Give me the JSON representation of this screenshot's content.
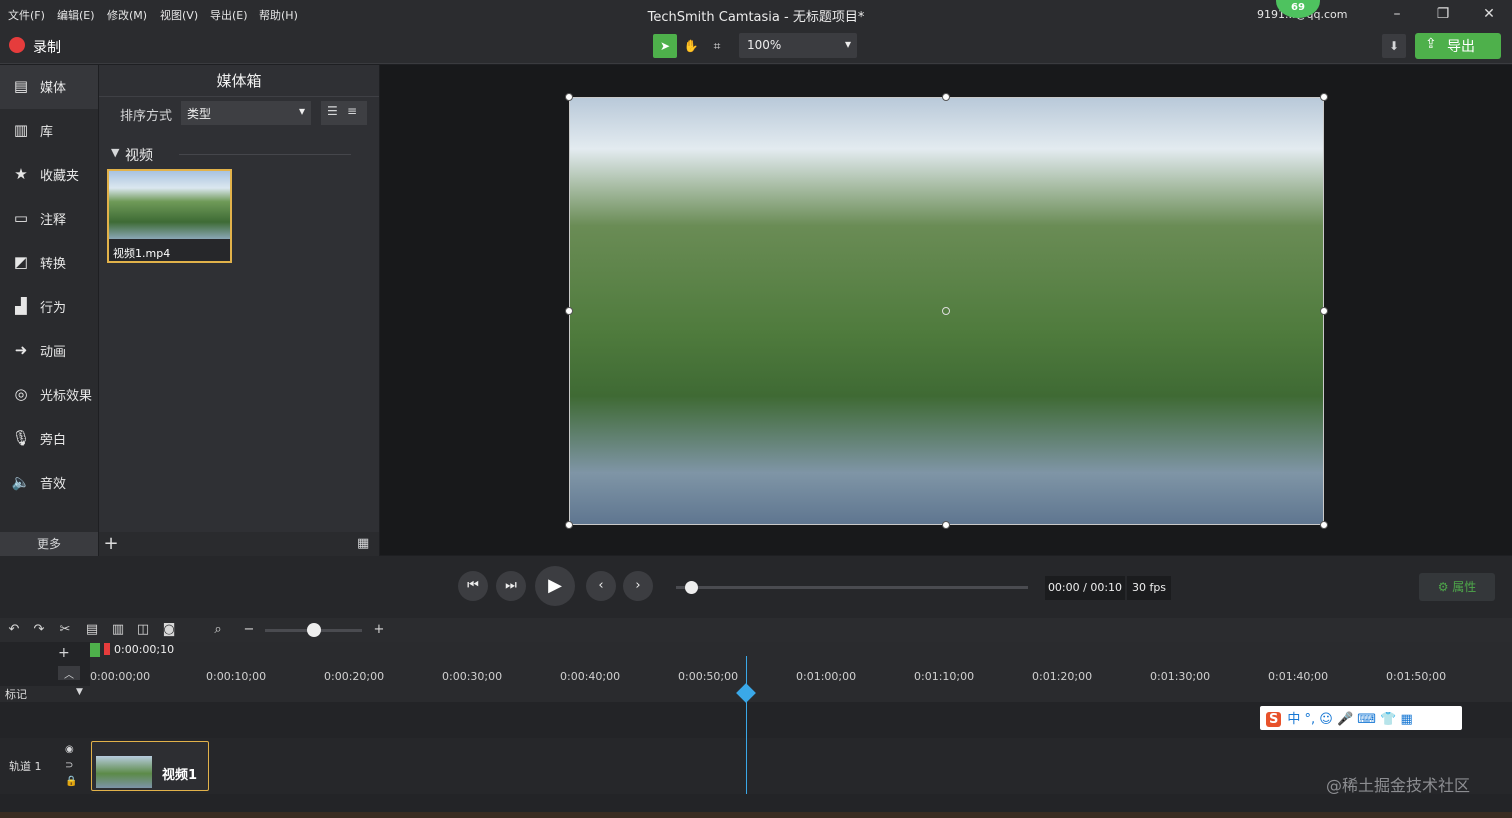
{
  "menu": [
    "文件(F)",
    "编辑(E)",
    "修改(M)",
    "视图(V)",
    "导出(E)",
    "帮助(H)"
  ],
  "title": "TechSmith Camtasia - 无标题项目*",
  "account": "9191...@qq.com",
  "badge": "69",
  "record_label": "录制",
  "zoom": "100%",
  "export_label": "导出",
  "sidebar": [
    "媒体",
    "库",
    "收藏夹",
    "注释",
    "转换",
    "行为",
    "动画",
    "光标效果",
    "旁白",
    "音效"
  ],
  "more_label": "更多",
  "media_panel": {
    "title": "媒体箱",
    "sort_label": "排序方式",
    "sort_value": "类型",
    "group": "视频",
    "item": "视频1.mp4"
  },
  "playback": {
    "time": "00:00 / 00:10",
    "fps": "30 fps",
    "prop_label": "属性"
  },
  "timeline": {
    "current": "0:00:00;10",
    "ticks": [
      "0:00:00;00",
      "0:00:10;00",
      "0:00:20;00",
      "0:00:30;00",
      "0:00:40;00",
      "0:00:50;00",
      "0:01:00;00",
      "0:01:10;00",
      "0:01:20;00",
      "0:01:30;00",
      "0:01:40;00",
      "0:01:50;00"
    ],
    "marker_label": "标记",
    "track_label": "轨道 1",
    "clip_label": "视频1"
  },
  "ime": "中 °, ☺ 🎤 ⌨ 👕 ▦",
  "watermark": "@稀土掘金技术社区"
}
